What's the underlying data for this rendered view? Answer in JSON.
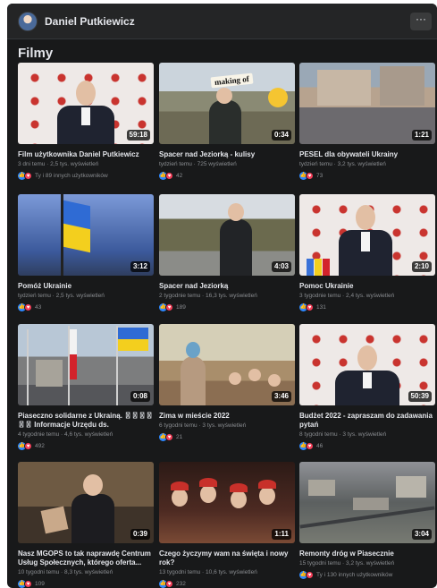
{
  "header": {
    "page_name": "Daniel Putkiewicz",
    "more_label": "···"
  },
  "section": {
    "title": "Filmy"
  },
  "videos": [
    {
      "title": "Film użytkownika Daniel Putkiewicz",
      "meta": "3 dni temu · 2,5 tys. wyświetleń",
      "reactions": "Ty i 89 innych użytkowników",
      "duration": "59:18"
    },
    {
      "title": "Spacer nad Jeziorką - kulisy",
      "meta": "tydzień temu · 725 wyświetleń",
      "reactions": "42",
      "duration": "0:34",
      "sticker": "making of"
    },
    {
      "title": "PESEL dla obywateli Ukrainy",
      "meta": "tydzień temu · 3,2 tys. wyświetleń",
      "reactions": "73",
      "duration": "1:21"
    },
    {
      "title": "Pomóż Ukrainie",
      "meta": "tydzień temu · 2,5 tys. wyświetleń",
      "reactions": "43",
      "duration": "3:12"
    },
    {
      "title": "Spacer nad Jeziorką",
      "meta": "2 tygodnie temu · 16,3 tys. wyświetleń",
      "reactions": "189",
      "duration": "4:03"
    },
    {
      "title": "Pomoc Ukrainie",
      "meta": "3 tygodnie temu · 2,4 tys. wyświetleń",
      "reactions": "131",
      "duration": "2:10"
    },
    {
      "title": "Piaseczno solidarne z Ukrainą. 〿〿〿〿〿〿 Informacje Urzędu ds. cudzoziemców ...",
      "meta": "4 tygodnie temu · 4,6 tys. wyświetleń",
      "reactions": "492",
      "duration": "0:08"
    },
    {
      "title": "Zima w mieście 2022",
      "meta": "6 tygodni temu · 3 tys. wyświetleń",
      "reactions": "21",
      "duration": "3:46"
    },
    {
      "title": "Budżet 2022 - zapraszam do zadawania pytań",
      "meta": "8 tygodni temu · 3 tys. wyświetleń",
      "reactions": "46",
      "duration": "50:39"
    },
    {
      "title": "Nasz MGOPS to tak naprawdę Centrum Usług Społecznych, którego oferta...",
      "meta": "10 tygodni temu · 8,3 tys. wyświetleń",
      "reactions": "109",
      "duration": "0:39"
    },
    {
      "title": "Czego życzymy wam na święta i nowy rok?",
      "meta": "13 tygodni temu · 10,6 tys. wyświetleń",
      "reactions": "232",
      "duration": "1:11"
    },
    {
      "title": "Remonty dróg w Piasecznie",
      "meta": "15 tygodni temu · 3,2 tys. wyświetleń",
      "reactions": "Ty i 130 innych użytkowników",
      "duration": "3:04"
    }
  ],
  "icons": {
    "like": "like-reaction-icon",
    "love": "love-reaction-icon"
  },
  "colors": {
    "background": "#18191a",
    "header": "#242526",
    "like": "#2d88ff",
    "love": "#f33e58"
  }
}
